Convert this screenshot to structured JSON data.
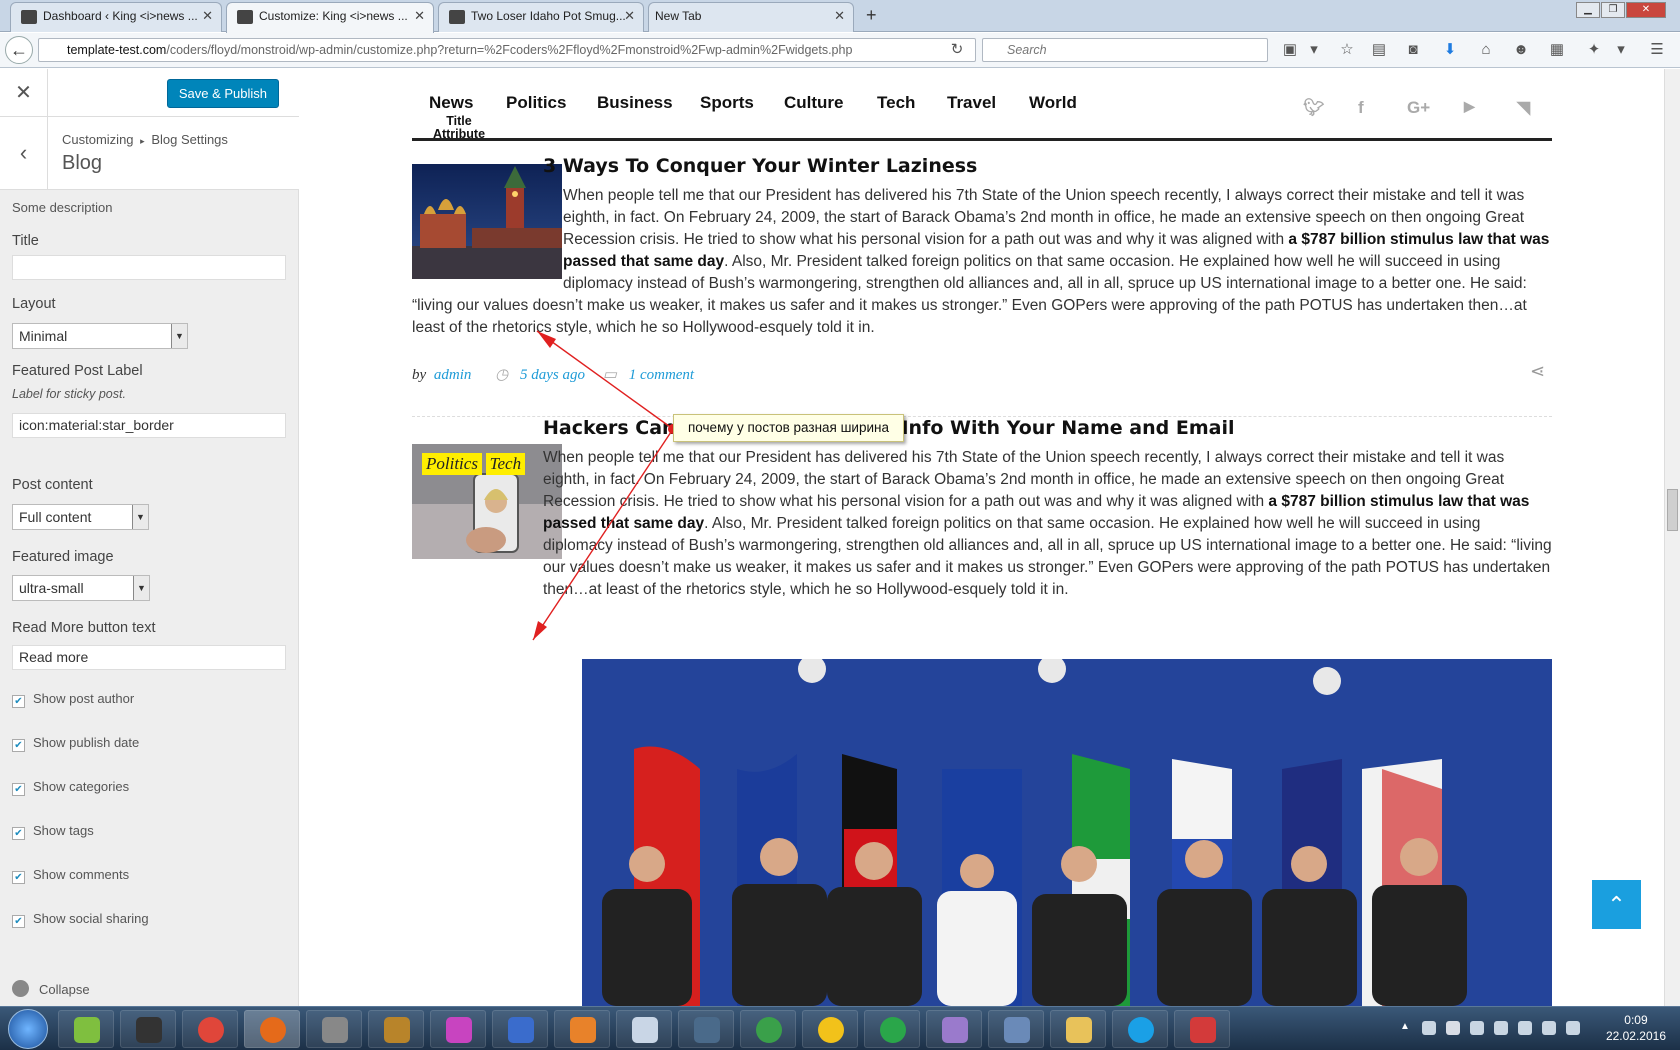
{
  "browser": {
    "tabs": [
      {
        "title": "Dashboard ‹ King <i>news ...",
        "active": false
      },
      {
        "title": "Customize: King <i>news ...",
        "active": true
      },
      {
        "title": "Two Loser Idaho Pot Smug...",
        "active": false
      },
      {
        "title": "New Tab",
        "active": false
      }
    ],
    "url_domain": "template-test.com",
    "url_path": "/coders/floyd/monstroid/wp-admin/customize.php?return=%2Fcoders%2Ffloyd%2Fmonstroid%2Fwp-admin%2Fwidgets.php",
    "search_placeholder": "Search"
  },
  "customizer": {
    "save_label": "Save & Publish",
    "breadcrumb_root": "Customizing",
    "breadcrumb_sep": "▸",
    "breadcrumb_section": "Blog Settings",
    "section_title": "Blog",
    "description": "Some description",
    "title_label": "Title",
    "title_value": "",
    "layout_label": "Layout",
    "layout_value": "Minimal",
    "featured_label": "Featured Post Label",
    "featured_desc": "Label for sticky post.",
    "featured_value": "icon:material:star_border",
    "content_label": "Post content",
    "content_value": "Full content",
    "image_label": "Featured image",
    "image_value": "ultra-small",
    "readmore_label": "Read More button text",
    "readmore_value": "Read more",
    "checkboxes": [
      {
        "label": "Show post author",
        "checked": true
      },
      {
        "label": "Show publish date",
        "checked": true
      },
      {
        "label": "Show categories",
        "checked": true
      },
      {
        "label": "Show tags",
        "checked": true
      },
      {
        "label": "Show comments",
        "checked": true
      },
      {
        "label": "Show social sharing",
        "checked": true
      }
    ],
    "collapse_label": "Collapse"
  },
  "site": {
    "nav": [
      "News",
      "Politics",
      "Business",
      "Sports",
      "Culture",
      "Tech",
      "Travel",
      "World"
    ],
    "nav_tooltip": "Title Attribute",
    "social_icons": [
      "twitter-icon",
      "facebook-icon",
      "google-plus-icon",
      "youtube-icon",
      "rss-icon"
    ],
    "posts": [
      {
        "title": "3 Ways To Conquer Your Winter Laziness",
        "body_a": "When people tell me that our President has delivered his 7th State of the Union speech recently, I always correct their mistake and tell it was eighth, in fact. On February 24, 2009, the start of Barack Obama’s 2nd month in office, he made an extensive speech on then ongoing Great Recession crisis. He tried to show what his personal vision for a path out was and why it was aligned with ",
        "body_bold": "a $787 billion stimulus law that was passed that same day",
        "body_b": ". Also, Mr. President talked foreign politics on that same occasion. He explained how well he will succeed in using diplomacy instead of Bush’s warmongering, strengthen old alliances and, all in all, spruce up US international image to a better one. He said: “living our values doesn’t make us weaker, it makes us safer and it makes us stronger.” Even GOPers were approving of the path POTUS has undertaken then…at least of the rhetorics style, which he so Hollywood-esquely told it in.",
        "meta_by": "by",
        "meta_author": "admin",
        "meta_date": "5 days ago",
        "meta_comments": "1 comment"
      },
      {
        "title": "Hackers Can Steal Your Financial Info With Your Name and Email",
        "tags": [
          "Politics",
          "Tech"
        ],
        "body_a": "When people tell me that our President has delivered his 7th State of the Union speech recently, I always correct their mistake and tell it was eighth, in fact. On February 24, 2009, the start of Barack Obama’s 2nd month in office, he made an extensive speech on then ongoing Great Recession crisis. He tried to show what his personal vision for a path out was and why it was aligned with ",
        "body_bold": "a $787 billion stimulus law that was passed that same day",
        "body_b": ". Also, Mr. President talked foreign politics on that same occasion. He explained how well he will succeed in using diplomacy instead of Bush’s warmongering, strengthen old alliances and, all in all, spruce up US international image to a better one. He said: “living our values doesn’t make us weaker, it makes us safer and it makes us stronger.” Even GOPers were approving of the path POTUS has undertaken then…at least of the rhetorics style, which he so Hollywood-esquely told it in."
      }
    ]
  },
  "annotation": {
    "text": "почему у постов разная ширина"
  },
  "taskbar": {
    "time": "0:09",
    "date": "22.02.2016"
  },
  "colors": {
    "primary": "#0085ba",
    "link": "#1e9bd7",
    "tag": "#ffee00",
    "totop": "#1a9fdf"
  }
}
